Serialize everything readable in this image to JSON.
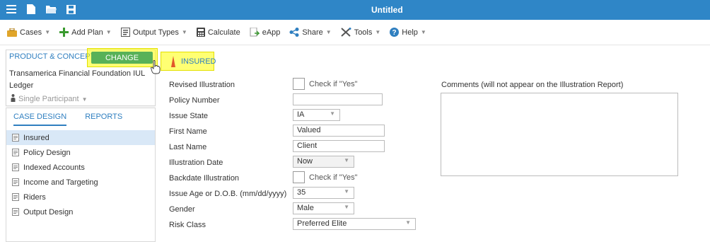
{
  "titlebar": {
    "title": "Untitled"
  },
  "toolbar": {
    "cases": "Cases",
    "add_plan": "Add Plan",
    "output_types": "Output Types",
    "calculate": "Calculate",
    "eapp": "eApp",
    "share": "Share",
    "tools": "Tools",
    "help": "Help"
  },
  "left_top": {
    "product_concept": "PRODUCT & CONCEPT",
    "change_label": "CHANGE",
    "plan_name": "Transamerica Financial Foundation IUL Ledger",
    "participant": "Single Participant"
  },
  "left_nav": {
    "tabs": [
      "CASE DESIGN",
      "REPORTS"
    ],
    "items": [
      "Insured",
      "Policy Design",
      "Indexed Accounts",
      "Income and Targeting",
      "Riders",
      "Output Design"
    ]
  },
  "main": {
    "section_title": "INSURED",
    "fields": {
      "revised_label": "Revised Illustration",
      "revised_check": "Check if \"Yes\"",
      "policy_number_label": "Policy Number",
      "policy_number_value": "",
      "issue_state_label": "Issue State",
      "issue_state_value": "IA",
      "first_name_label": "First Name",
      "first_name_value": "Valued",
      "last_name_label": "Last Name",
      "last_name_value": "Client",
      "illustration_date_label": "Illustration Date",
      "illustration_date_value": "Now",
      "backdate_label": "Backdate Illustration",
      "backdate_check": "Check if \"Yes\"",
      "issue_age_label": "Issue Age or D.O.B. (mm/dd/yyyy)",
      "issue_age_value": "35",
      "gender_label": "Gender",
      "gender_value": "Male",
      "risk_class_label": "Risk Class",
      "risk_class_value": "Preferred Elite"
    },
    "comments_label": "Comments (will not appear on the Illustration Report)"
  },
  "colors": {
    "titlebar": "#2f86c7",
    "link": "#2f7fc0",
    "change_button": "#58b158",
    "highlight": "#ffff00",
    "selected_nav": "#d9e8f7"
  }
}
